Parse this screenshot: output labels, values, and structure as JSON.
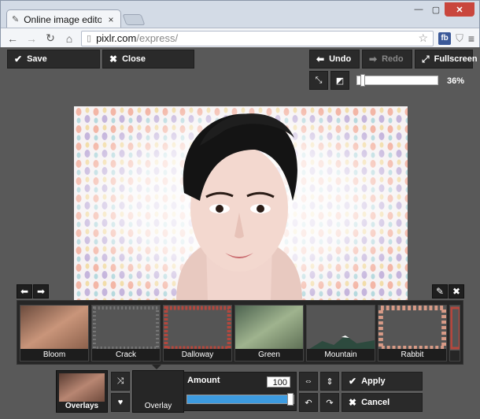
{
  "browser": {
    "tab_title": "Online image editor pix",
    "url_host": "pixlr.com",
    "url_path": "/express/",
    "fb_badge": "fb"
  },
  "editor": {
    "save_label": "Save",
    "close_label": "Close",
    "undo_label": "Undo",
    "redo_label": "Redo",
    "fullscreen_label": "Fullscreen",
    "zoom_label": "36%",
    "zoom_fraction": 0.04
  },
  "filters": [
    {
      "label": "Bloom"
    },
    {
      "label": "Crack"
    },
    {
      "label": "Dalloway"
    },
    {
      "label": "Green"
    },
    {
      "label": "Mountain"
    },
    {
      "label": "Rabbit"
    }
  ],
  "bottom_panel": {
    "category_label": "Overlays",
    "selected_overlay_label": "Overlay",
    "amount_label": "Amount",
    "amount_value": "100",
    "amount_fraction": 1.0,
    "apply_label": "Apply",
    "cancel_label": "Cancel"
  },
  "colors": {
    "app_bg": "#595959",
    "slider_fill": "#3d9be0",
    "close_button": "#c9463d"
  }
}
